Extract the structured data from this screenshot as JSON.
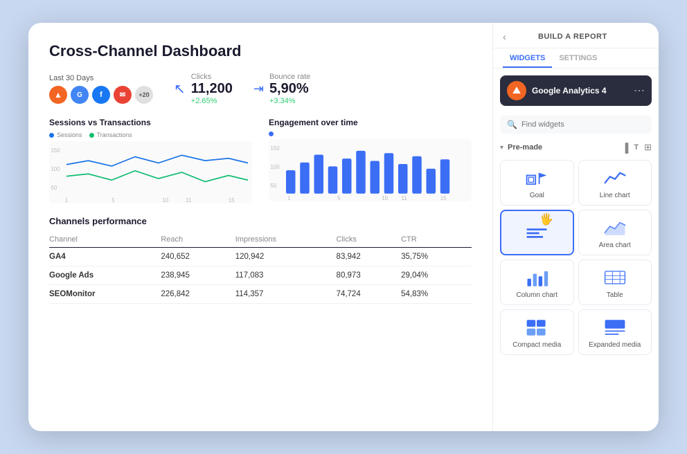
{
  "dashboard": {
    "title": "Cross-Channel Dashboard",
    "stats": {
      "period_label": "Last 30 Days",
      "more_label": "+20",
      "clicks_label": "Clicks",
      "clicks_value": "11,200",
      "clicks_change": "+2.65%",
      "bounce_label": "Bounce rate",
      "bounce_value": "5,90%",
      "bounce_change": "+3.34%"
    },
    "sessions_chart": {
      "title": "Sessions vs Transactions",
      "legend": [
        {
          "label": "Sessions",
          "color": "#1a73e8"
        },
        {
          "label": "Transactions",
          "color": "#0dbc6f"
        }
      ],
      "x_labels": [
        "1",
        "5",
        "10",
        "11",
        "15"
      ]
    },
    "engagement_chart": {
      "title": "Engagement over time",
      "x_labels": [
        "1",
        "5",
        "10",
        "11",
        "15"
      ],
      "y_labels": [
        "150",
        "100",
        "50"
      ]
    },
    "channels": {
      "title": "Channels performance",
      "headers": [
        "Channel",
        "Reach",
        "Impressions",
        "Clicks",
        "CTR"
      ],
      "rows": [
        {
          "channel": "GA4",
          "reach": "240,652",
          "impressions": "120,942",
          "clicks": "83,942",
          "ctr": "35,75%"
        },
        {
          "channel": "Google Ads",
          "reach": "238,945",
          "impressions": "117,083",
          "clicks": "80,973",
          "ctr": "29,04%"
        },
        {
          "channel": "SEOMonitor",
          "reach": "226,842",
          "impressions": "114,357",
          "clicks": "74,724",
          "ctr": "54,83%"
        }
      ]
    }
  },
  "right_panel": {
    "back_label": "‹",
    "header_title": "BUILD A REPORT",
    "tabs": [
      {
        "label": "WIDGETS",
        "active": true
      },
      {
        "label": "SETTINGS",
        "active": false
      }
    ],
    "ga4": {
      "label": "Google Analytics 4",
      "icon_text": "▲"
    },
    "search": {
      "placeholder": "Find widgets"
    },
    "premade": {
      "label": "Pre-made"
    },
    "widgets": [
      {
        "name": "goal",
        "label": "Goal",
        "type": "goal"
      },
      {
        "name": "line-chart",
        "label": "Line chart",
        "type": "line"
      },
      {
        "name": "bar-widget",
        "label": "",
        "type": "bar-widget",
        "selected": true
      },
      {
        "name": "area-chart",
        "label": "Area chart",
        "type": "area"
      },
      {
        "name": "column-chart",
        "label": "Column chart",
        "type": "column"
      },
      {
        "name": "table",
        "label": "Table",
        "type": "table"
      },
      {
        "name": "compact-media",
        "label": "Compact media",
        "type": "compact-media"
      },
      {
        "name": "expanded-media",
        "label": "Expanded media",
        "type": "expanded-media"
      }
    ]
  }
}
